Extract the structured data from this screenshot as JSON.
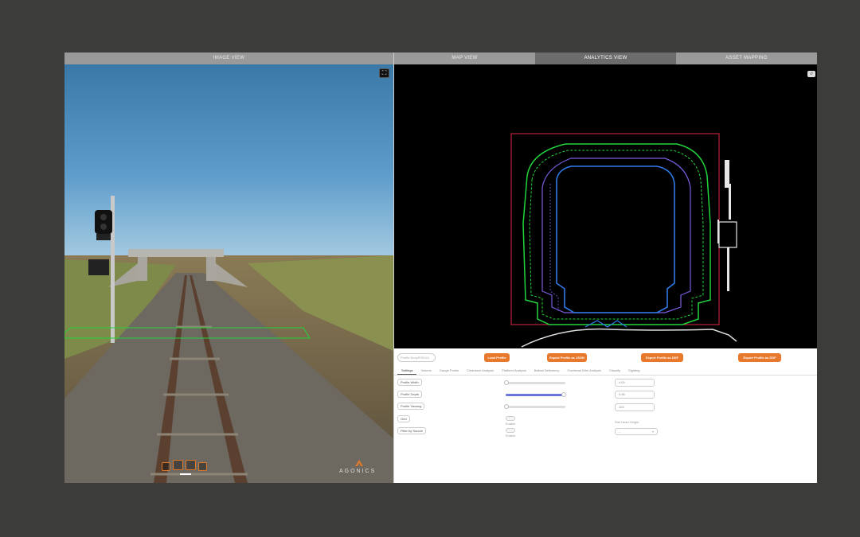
{
  "left_panel": {
    "tab_label": "IMAGE VIEW",
    "brand": "AGONICS"
  },
  "right_panel": {
    "tabs": [
      {
        "label": "MAP VIEW",
        "active": false
      },
      {
        "label": "ANALYTICS VIEW",
        "active": true
      },
      {
        "label": "ASSET MAPPING",
        "active": false
      }
    ],
    "profile_input_placeholder": "Profile BodyR25Vch",
    "buttons": {
      "load_profile": "Load Profile",
      "export_json": "Export Profile as JSON",
      "export_ddf_1": "Export Profile as DDF",
      "export_ddf_2": "Export Profile as DDF"
    },
    "subtabs": [
      "Settings",
      "Volume",
      "Gauge Points",
      "Clearance Analysis",
      "Platform Analysis",
      "Ballast Deficiency",
      "Overhead Wire Analysis",
      "Classify",
      "Sighting"
    ],
    "settings": {
      "profile_width_label": "Profile Width",
      "profile_depth_label": "Profile Depth",
      "profile_viewing_label": "Profile Viewing",
      "grid_label": "Grid",
      "filter_by_source_label": "Filter by Source",
      "profile_width_value": "4.00",
      "profile_depth_value": "0.56",
      "profile_viewing_value": "100",
      "grid_toggle_label": "Enable",
      "filter_toggle_label": "Enable",
      "rail_head_label": "Rail Head Height",
      "rail_head_select": "--"
    }
  },
  "colors": {
    "accent_orange": "#e8782c",
    "slider_blue": "#6c75d8",
    "tab_active": "#6c6c6c",
    "tab_inactive": "#9a9a9a"
  }
}
